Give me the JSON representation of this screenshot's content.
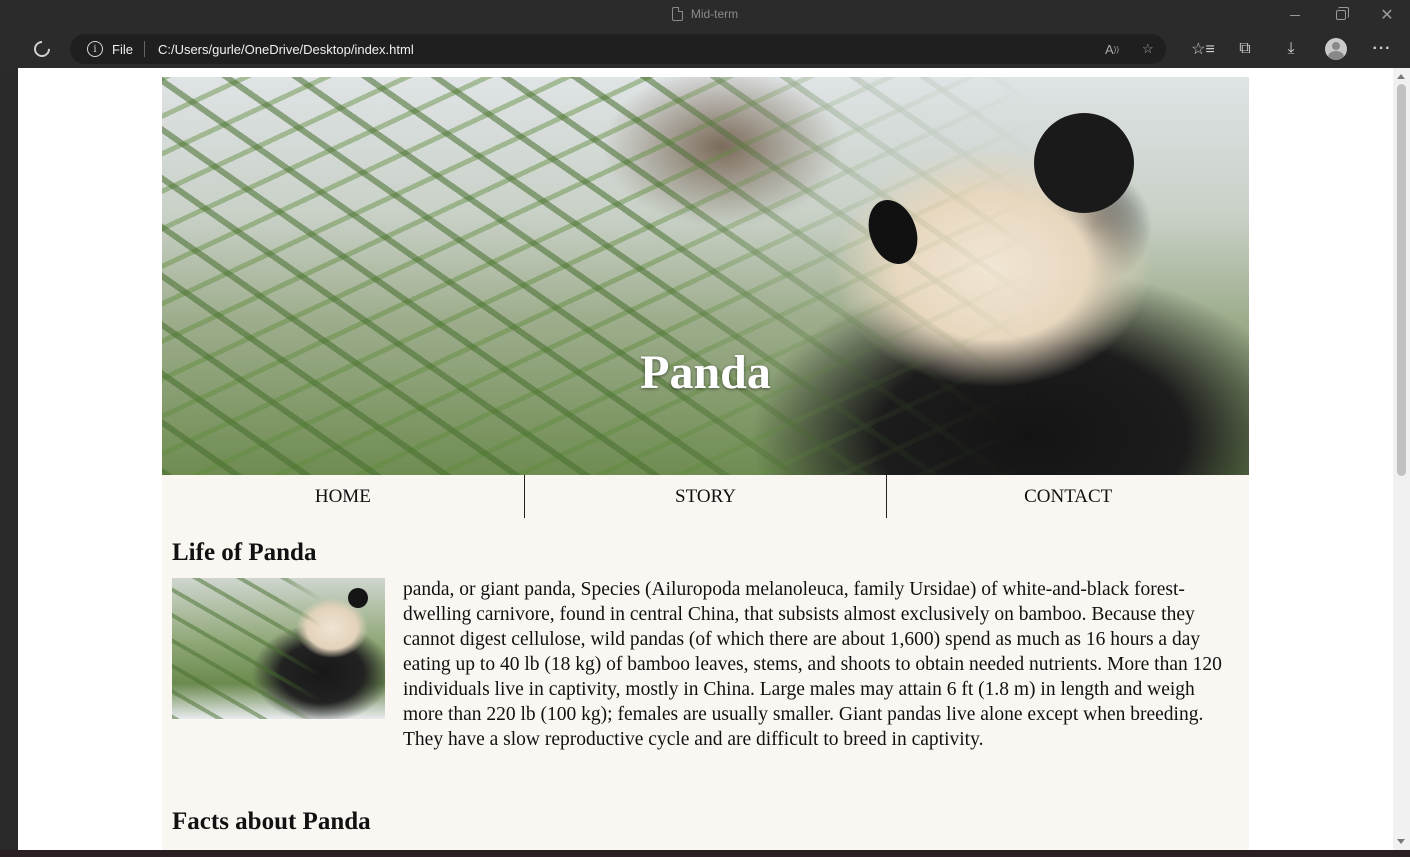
{
  "window": {
    "title": "Mid-term"
  },
  "address_bar": {
    "scheme": "File",
    "url": "C:/Users/gurle/OneDrive/Desktop/index.html"
  },
  "hero": {
    "title": "Panda"
  },
  "nav": {
    "items": [
      {
        "label": "HOME"
      },
      {
        "label": "STORY"
      },
      {
        "label": "CONTACT"
      }
    ]
  },
  "sections": {
    "life": {
      "title": "Life of Panda",
      "text": "panda, or giant panda, Species (Ailuropoda melanoleuca, family Ursidae) of white-and-black forest-dwelling carnivore, found in central China, that subsists almost exclusively on bamboo. Because they cannot digest cellulose, wild pandas (of which there are about 1,600) spend as much as 16 hours a day eating up to 40 lb (18 kg) of bamboo leaves, stems, and shoots to obtain needed nutrients. More than 120 individuals live in captivity, mostly in China. Large males may attain 6 ft (1.8 m) in length and weigh more than 220 lb (100 kg); females are usually smaller. Giant pandas live alone except when breeding. They have a slow reproductive cycle and are difficult to breed in captivity."
    },
    "facts": {
      "title": "Facts about Panda"
    }
  },
  "icons": {
    "reload": "reload-icon",
    "info": "info-icon",
    "read_aloud": "read-aloud-icon",
    "add_favorite": "add-favorite-icon",
    "favorites": "favorites-icon",
    "collections": "collections-icon",
    "downloads": "downloads-icon",
    "profile": "profile-icon",
    "menu": "more-menu-icon"
  }
}
